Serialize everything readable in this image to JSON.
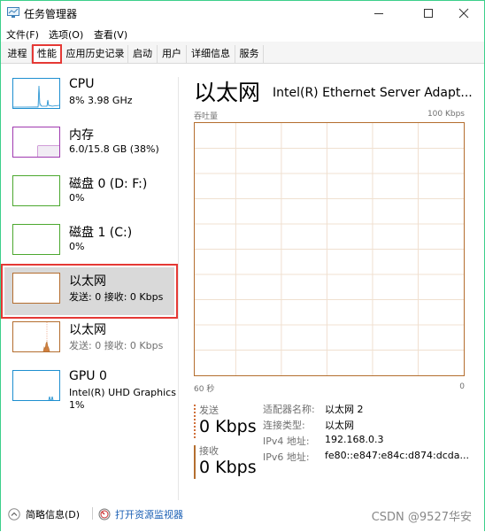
{
  "window": {
    "title": "任务管理器",
    "controls": {
      "minimize": "minimize",
      "maximize": "maximize",
      "close": "close"
    }
  },
  "menu": [
    "文件(F)",
    "选项(O)",
    "查看(V)"
  ],
  "tabs": [
    {
      "label": "进程",
      "active": false
    },
    {
      "label": "性能",
      "active": true
    },
    {
      "label": "应用历史记录",
      "active": false
    },
    {
      "label": "启动",
      "active": false
    },
    {
      "label": "用户",
      "active": false
    },
    {
      "label": "详细信息",
      "active": false
    },
    {
      "label": "服务",
      "active": false
    }
  ],
  "sidebar": {
    "items": [
      {
        "name": "CPU",
        "sub": "8% 3.98 GHz",
        "sub2": "",
        "color": "#1e8fd0"
      },
      {
        "name": "内存",
        "sub": "6.0/15.8 GB (38%)",
        "sub2": "",
        "color": "#a03ab0"
      },
      {
        "name": "磁盘 0 (D: F:)",
        "sub": "0%",
        "sub2": "",
        "color": "#4ca82f"
      },
      {
        "name": "磁盘 1 (C:)",
        "sub": "0%",
        "sub2": "",
        "color": "#4ca82f"
      },
      {
        "name": "以太网",
        "sub": "发送: 0 接收: 0 Kbps",
        "sub2": "",
        "color": "#b46e2f",
        "selected": true
      },
      {
        "name": "以太网",
        "sub": "发送: 0 接收: 0 Kbps",
        "sub2": "",
        "color": "#b46e2f"
      },
      {
        "name": "GPU 0",
        "sub": "Intel(R) UHD Graphics",
        "sub2": "1%",
        "color": "#1e8fd0"
      }
    ]
  },
  "main": {
    "title": "以太网",
    "adapter": "Intel(R) Ethernet Server Adapt...",
    "graph": {
      "ylabel": "吞吐量",
      "ymax_label": "100 Kbps",
      "x_left": "60 秒",
      "x_right": "0",
      "accent": "#b46e2f",
      "grid": "#f0e0d0"
    },
    "send": {
      "label": "发送",
      "value": "0 Kbps"
    },
    "recv": {
      "label": "接收",
      "value": "0 Kbps"
    },
    "props": [
      {
        "key": "适配器名称:",
        "value": "以太网 2"
      },
      {
        "key": "连接类型:",
        "value": "以太网"
      },
      {
        "key": "IPv4 地址:",
        "value": "192.168.0.3"
      },
      {
        "key": "IPv6 地址:",
        "value": "fe80::e847:e84c:d874:dcda..."
      }
    ]
  },
  "footer": {
    "brief": "简略信息(D)",
    "resmon": "打开资源监视器",
    "watermark": "CSDN @9527华安"
  }
}
